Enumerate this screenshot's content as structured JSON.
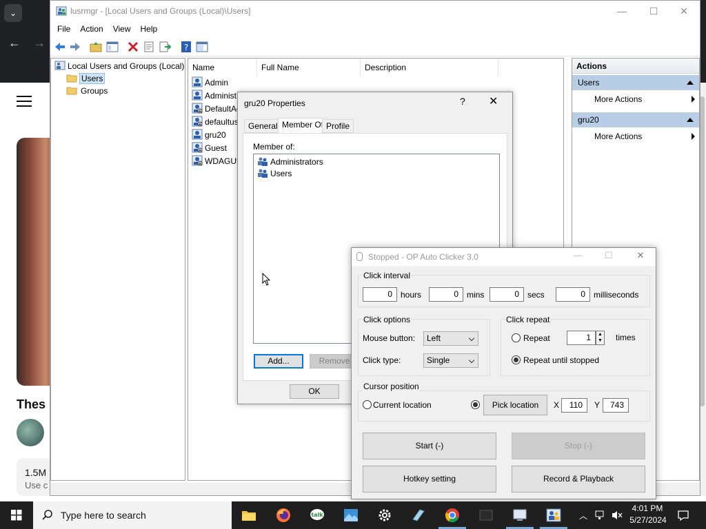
{
  "mmc": {
    "title": "lusrmgr - [Local Users and Groups (Local)\\Users]",
    "menu": [
      "File",
      "Action",
      "View",
      "Help"
    ],
    "tree": {
      "root": "Local Users and Groups (Local)",
      "children": [
        "Users",
        "Groups"
      ],
      "selected": "Users"
    },
    "list": {
      "columns": [
        "Name",
        "Full Name",
        "Description"
      ],
      "rows": [
        "Admin",
        "Administ",
        "DefaultAc",
        "defaultus",
        "gru20",
        "Guest",
        "WDAGUti"
      ]
    },
    "actions": {
      "header": "Actions",
      "sections": [
        {
          "title": "Users",
          "items": [
            "More Actions"
          ]
        },
        {
          "title": "gru20",
          "items": [
            "More Actions"
          ]
        }
      ]
    }
  },
  "properties": {
    "title": "gru20 Properties",
    "help": "?",
    "tabs": [
      "General",
      "Member Of",
      "Profile"
    ],
    "active_tab": "Member Of",
    "member_of_label": "Member of:",
    "groups": [
      "Administrators",
      "Users"
    ],
    "add_label": "Add...",
    "remove_label": "Remove",
    "ok_label": "OK"
  },
  "autoclicker": {
    "title": "Stopped - OP Auto Clicker 3.0",
    "click_interval": {
      "label": "Click interval",
      "hours": "0",
      "hours_label": "hours",
      "mins": "0",
      "mins_label": "mins",
      "secs": "0",
      "secs_label": "secs",
      "ms": "0",
      "ms_label": "milliseconds"
    },
    "click_options": {
      "label": "Click options",
      "mouse_button_label": "Mouse button:",
      "mouse_button": "Left",
      "click_type_label": "Click type:",
      "click_type": "Single"
    },
    "click_repeat": {
      "label": "Click repeat",
      "repeat_label": "Repeat",
      "repeat_count": "1",
      "times_label": "times",
      "until_stopped_label": "Repeat until stopped",
      "selected": "until_stopped"
    },
    "cursor_position": {
      "label": "Cursor position",
      "current_label": "Current location",
      "pick_label": "Pick location",
      "x_label": "X",
      "x": "110",
      "y_label": "Y",
      "y": "743"
    },
    "start_label": "Start (-)",
    "stop_label": "Stop (-)",
    "hotkey_label": "Hotkey setting",
    "record_label": "Record & Playback"
  },
  "background_page": {
    "title_fragment": "Thes",
    "views": "1.5M",
    "use_fragment": "Use c"
  },
  "taskbar": {
    "search_placeholder": "Type here to search",
    "time": "4:01 PM",
    "date": "5/27/2024"
  },
  "colors": {
    "actions_section": "#b8cde6",
    "taskbar": "#1f1f1f",
    "focus_blue": "#0078d7"
  }
}
